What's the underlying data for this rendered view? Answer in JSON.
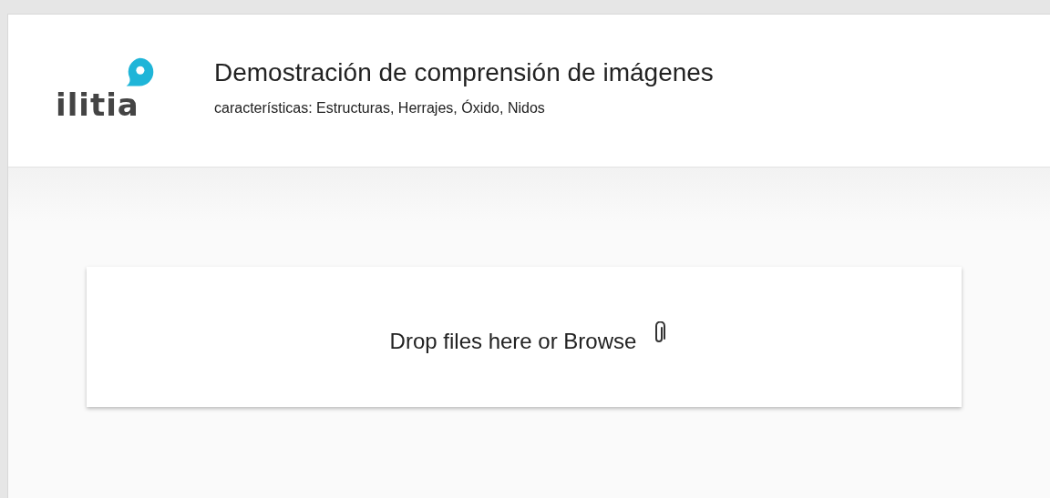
{
  "header": {
    "logo": "ilitia",
    "title": "Demostración de comprensión de imágenes",
    "subtitle": "características: Estructuras, Herrajes, Óxido, Nidos"
  },
  "dropzone": {
    "label": "Drop files here or Browse"
  }
}
